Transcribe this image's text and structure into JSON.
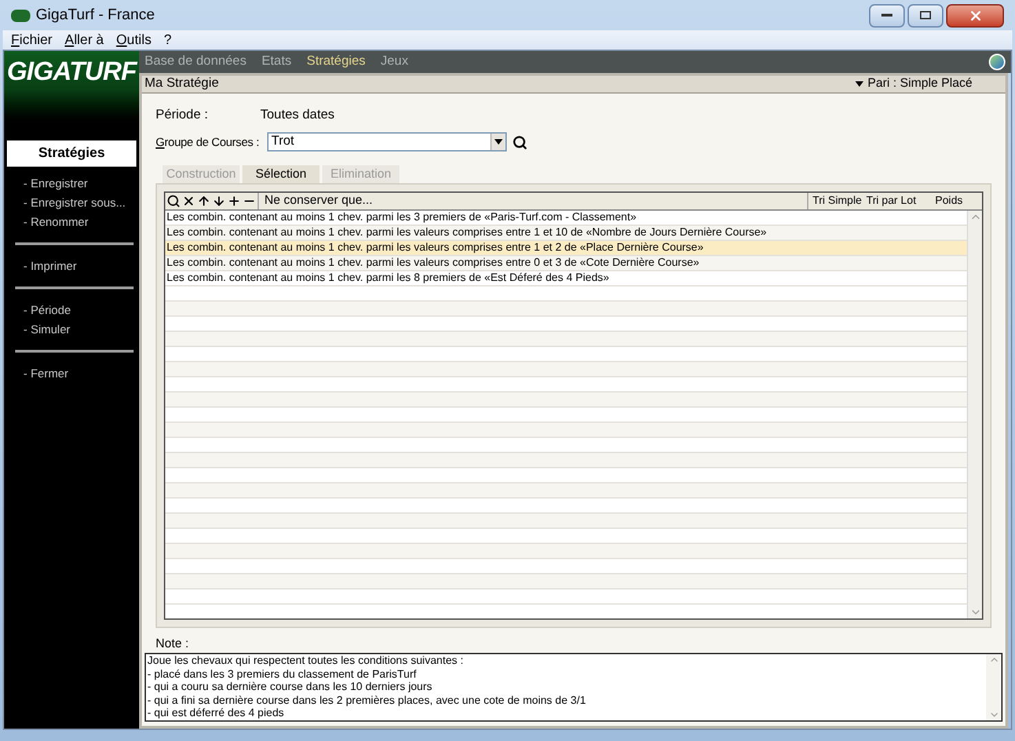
{
  "window": {
    "title": "GigaTurf - France"
  },
  "menu": [
    "Fichier",
    "Aller à",
    "Outils",
    "?"
  ],
  "logo": "GIGATURF",
  "sidebar": {
    "title": "Stratégies",
    "groups": [
      [
        "- Enregistrer",
        "- Enregistrer sous...",
        "- Renommer"
      ],
      [
        "- Imprimer"
      ],
      [
        "- Période",
        "- Simuler"
      ],
      [
        "- Fermer"
      ]
    ]
  },
  "nav": [
    {
      "label": "Base de données",
      "selected": false
    },
    {
      "label": "Etats",
      "selected": false
    },
    {
      "label": "Stratégies",
      "selected": true
    },
    {
      "label": "Jeux",
      "selected": false
    }
  ],
  "panel": {
    "title": "Ma Stratégie",
    "bet": "Pari : Simple Placé"
  },
  "period": {
    "label": "Période :",
    "value": "Toutes dates"
  },
  "group": {
    "label": "Groupe de Courses :",
    "value": "Trot"
  },
  "tabs": [
    {
      "label": "Construction",
      "selected": false
    },
    {
      "label": "Sélection",
      "selected": true
    },
    {
      "label": "Elimination",
      "selected": false
    }
  ],
  "table": {
    "columns": [
      "Ne conserver que...",
      "Tri Simple",
      "Tri par Lot",
      "Poids"
    ],
    "rows": [
      {
        "text": "Les combin. contenant au moins 1 chev. parmi les 3 premiers de «Paris-Turf.com - Classement»",
        "selected": false
      },
      {
        "text": "Les combin. contenant au moins 1 chev. parmi les valeurs comprises entre 1 et 10 de «Nombre de Jours Dernière Course»",
        "selected": false
      },
      {
        "text": "Les combin. contenant au moins 1 chev. parmi les valeurs comprises entre 1 et 2 de «Place Dernière Course»",
        "selected": true
      },
      {
        "text": "Les combin. contenant au moins 1 chev. parmi les valeurs comprises entre 0 et 3 de «Cote Dernière Course»",
        "selected": false
      },
      {
        "text": "Les combin. contenant au moins 1 chev. parmi les 8 premiers de «Est Déferé des 4 Pieds»",
        "selected": false
      }
    ]
  },
  "note": {
    "label": "Note :",
    "lines": [
      "Joue les chevaux qui respectent toutes les conditions suivantes :",
      "- placé dans les 3 premiers du classement de ParisTurf",
      "- qui a couru sa dernière course dans les 10 derniers jours",
      "- qui a fini sa dernière course dans les 2 premières places, avec une cote de moins de 3/1",
      "- qui est déferré des 4 pieds"
    ]
  }
}
